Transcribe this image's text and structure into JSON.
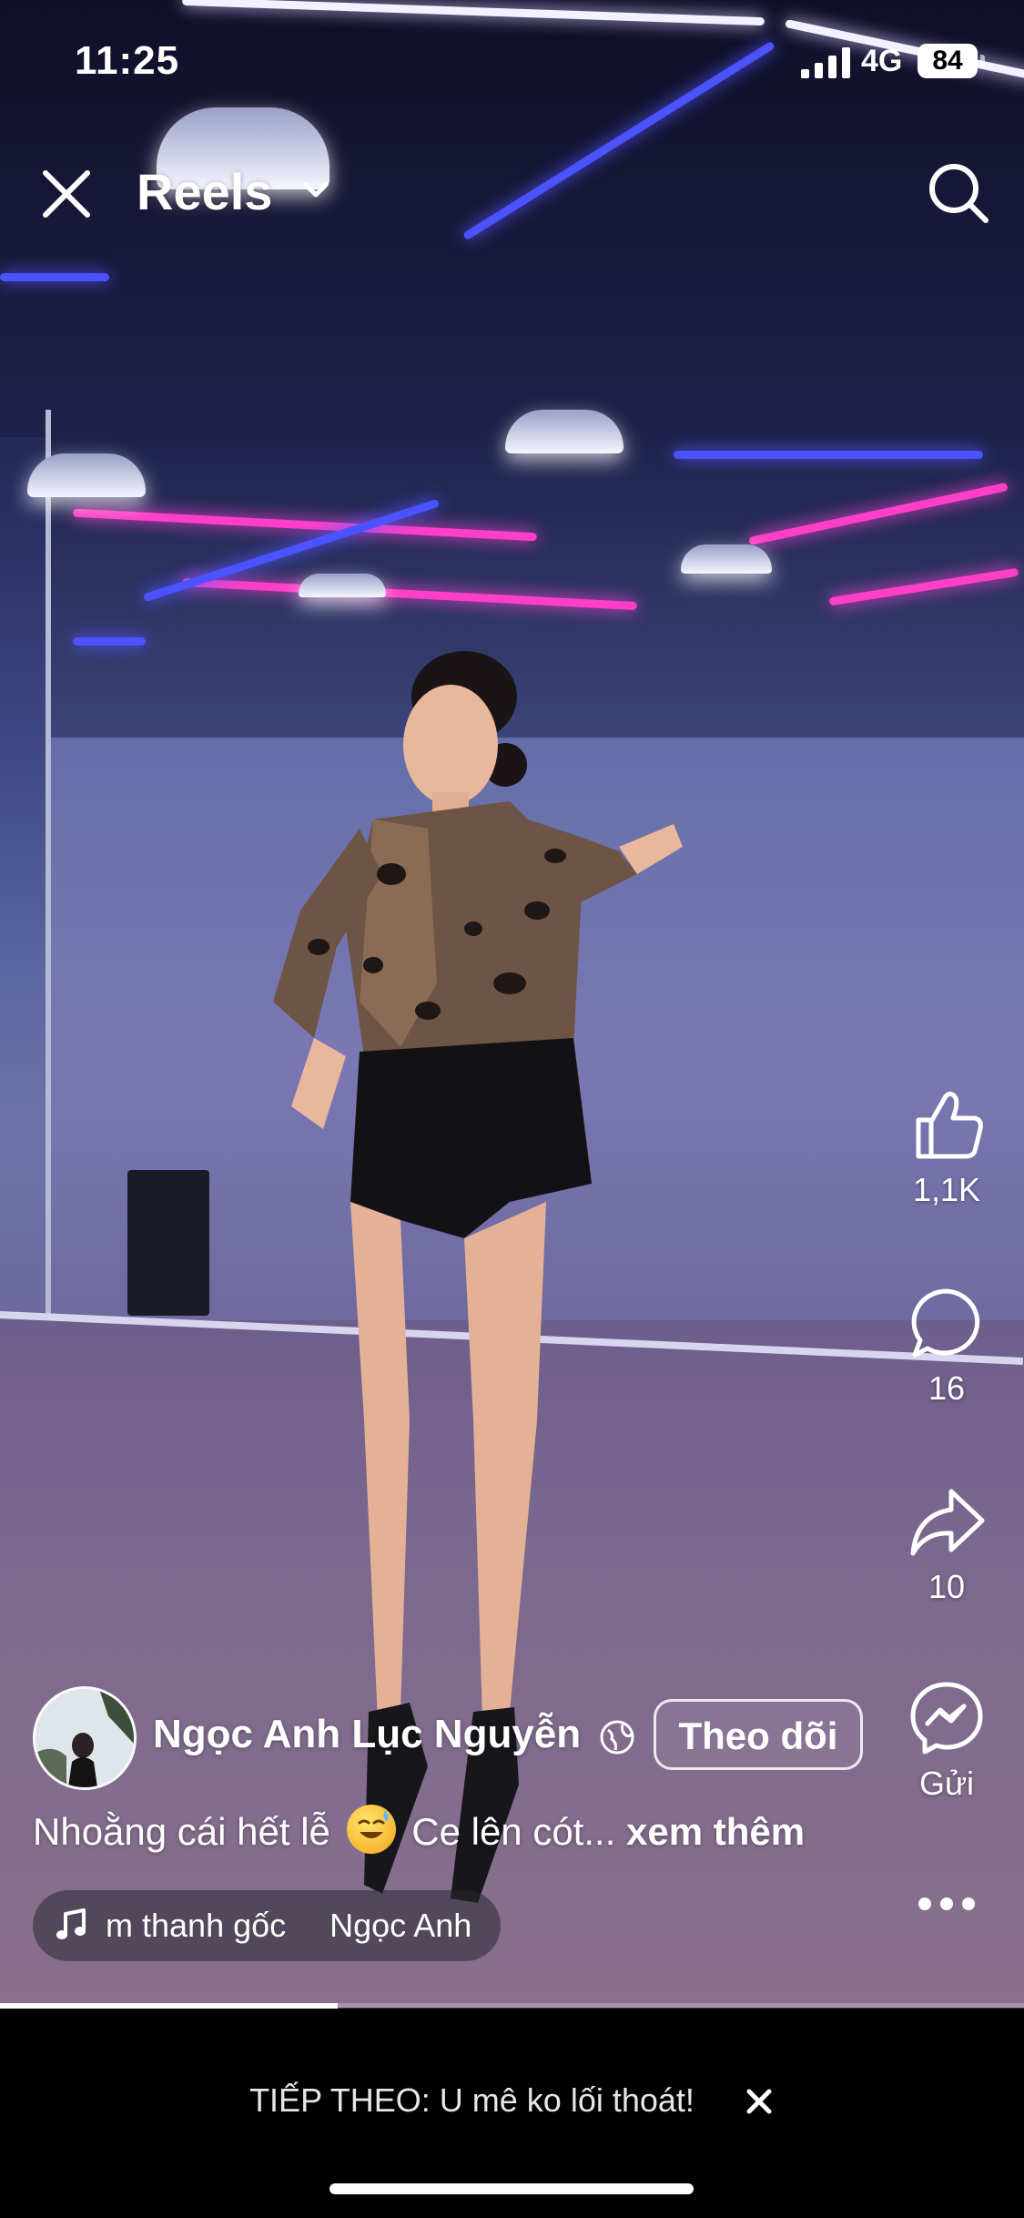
{
  "status_bar": {
    "time": "11:25",
    "network": "4G",
    "battery": "84"
  },
  "header": {
    "title": "Reels"
  },
  "actions": {
    "like_count": "1,1K",
    "comment_count": "16",
    "share_count": "10",
    "send_label": "Gửi"
  },
  "author": {
    "name": "Ngọc Anh Lục Nguyễn",
    "follow_label": "Theo dõi"
  },
  "caption": {
    "text_before": "Nhoằng cái hết lễ",
    "text_after": "Ce lên cót...",
    "more_label": "xem thêm"
  },
  "audio": {
    "text": "Âm thanh gốc",
    "artist": "Ngọc Anh"
  },
  "video": {
    "progress_fraction": 0.33
  },
  "next_up": {
    "text": "TIẾP THEO: U mê ko lối thoát!"
  },
  "colors": {
    "neon_pink": "#ff3fc8",
    "neon_blue": "#4b52ff",
    "background": "#000000"
  }
}
